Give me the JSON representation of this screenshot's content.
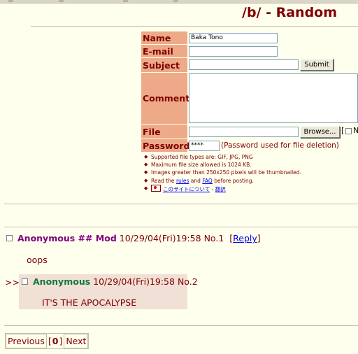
{
  "board": {
    "title": "/b/ - Random"
  },
  "form": {
    "name_label": "Name",
    "name_value": "Baka Tono",
    "email_label": "E-mail",
    "email_value": "",
    "subject_label": "Subject",
    "subject_value": "",
    "submit_label": "Submit",
    "comment_label": "Comment",
    "comment_value": "",
    "file_label": "File",
    "browse_label": "Browse...",
    "password_label": "Password",
    "password_value": "****",
    "password_note": "(Password used for file deletion)",
    "rules": {
      "r1": "Supported file types are: GIF, JPG, PNG",
      "r2": "Maximum file size allowed is 1024 KB.",
      "r3": "Images greater than 250x250 pixels will be thumbnailed.",
      "r4_pre": "Read the",
      "r4_rules": "rules",
      "r4_and": "and",
      "r4_faq": "FAQ",
      "r4_post": "before posting.",
      "r5_about": "このサイトについて",
      "r5_sep": "-",
      "r5_news": "翻訳"
    }
  },
  "posts": [
    {
      "name": "Anonymous ## Mod",
      "datetime": "10/29/04(Fri)19:58",
      "number": "No.1",
      "reply_open": "[",
      "reply_label": "Reply",
      "reply_close": "]",
      "message": "oops"
    },
    {
      "marker": ">>",
      "name": "Anonymous",
      "datetime": "10/29/04(Fri)19:58",
      "number": "No.2",
      "message": "IT'S THE APOCALYPSE"
    }
  ],
  "pagination": {
    "previous": "Previous",
    "current_open": "[",
    "current": "0",
    "current_close": "]",
    "next": "Next"
  }
}
